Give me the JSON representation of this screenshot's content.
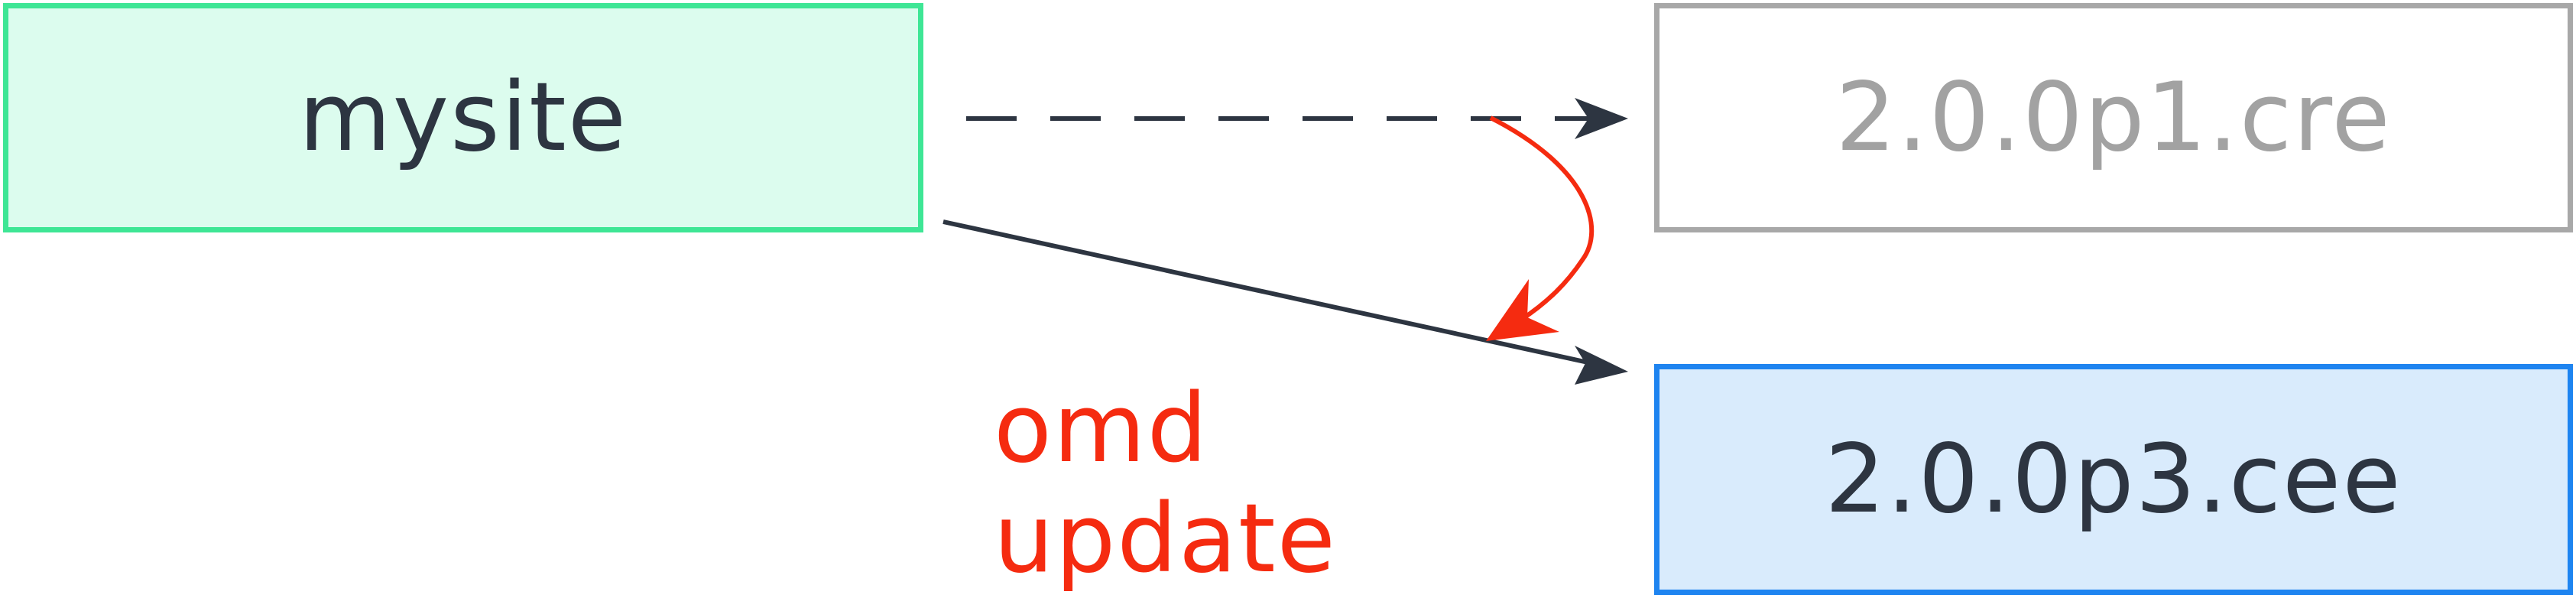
{
  "site": {
    "name": "mysite"
  },
  "versions": {
    "old": "2.0.0p1.cre",
    "new": "2.0.0p3.cee"
  },
  "command": {
    "label": "omd update"
  },
  "colors": {
    "text_dark": "#2d3541",
    "text_old": "#a2a2a2",
    "command": "#f52b10",
    "site_border": "#3ee695",
    "site_fill": "#dcfcee",
    "old_border": "#a8a8a8",
    "new_border": "#1e84f0",
    "new_fill": "#d9ebfc",
    "arrow_dark": "#2d3541",
    "arrow_red": "#f52b10"
  }
}
